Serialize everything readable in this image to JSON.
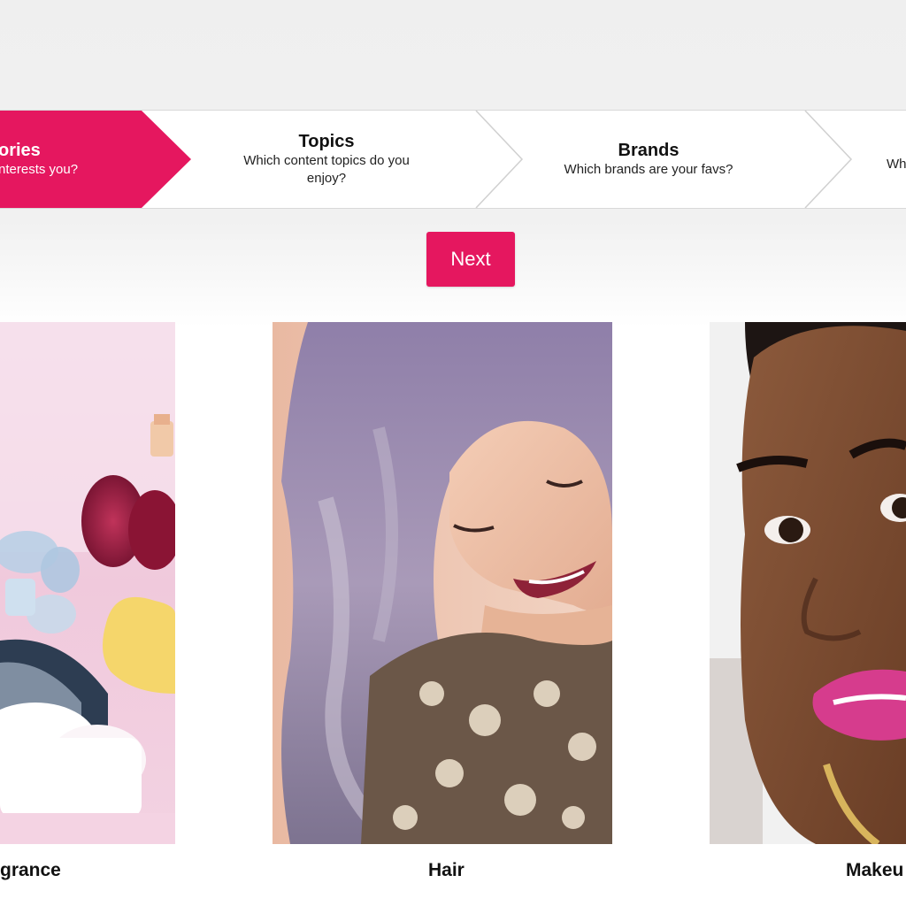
{
  "stepper": {
    "steps": [
      {
        "title": "ories",
        "subtitle": "nterests you?",
        "active": true
      },
      {
        "title": "Topics",
        "subtitle_line1": "Which content topics do you",
        "subtitle_line2": "enjoy?",
        "active": false
      },
      {
        "title": "Brands",
        "subtitle": "Which brands are your favs?",
        "active": false
      },
      {
        "title": "",
        "subtitle": "Wh",
        "active": false
      }
    ],
    "active_color": "#e5175f"
  },
  "next_button": {
    "label": "Next",
    "color": "#e5175f"
  },
  "categories": [
    {
      "label": "grance",
      "image": "perfume-bottles-photo"
    },
    {
      "label": "Hair",
      "image": "lavender-hair-woman-photo"
    },
    {
      "label": "Makeu",
      "image": "pink-lipstick-woman-photo"
    }
  ]
}
